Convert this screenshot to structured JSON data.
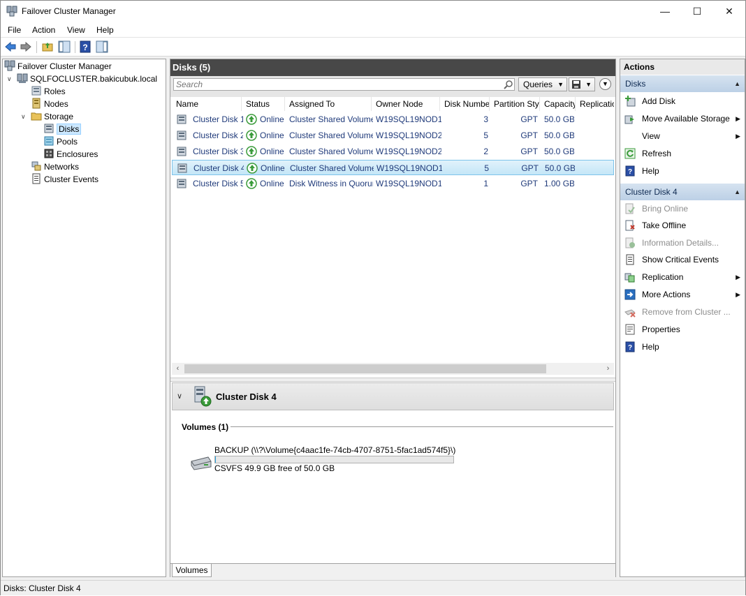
{
  "window": {
    "title": "Failover Cluster Manager"
  },
  "menu": [
    "File",
    "Action",
    "View",
    "Help"
  ],
  "tree": {
    "root": "Failover Cluster Manager",
    "cluster": "SQLFOCLUSTER.bakicubuk.local",
    "roles": "Roles",
    "nodes": "Nodes",
    "storage": "Storage",
    "disks": "Disks",
    "pools": "Pools",
    "enclosures": "Enclosures",
    "networks": "Networks",
    "events": "Cluster Events"
  },
  "center": {
    "title": "Disks (5)",
    "search_placeholder": "Search",
    "queries_label": "Queries",
    "columns": [
      "Name",
      "Status",
      "Assigned To",
      "Owner Node",
      "Disk Number",
      "Partition Style",
      "Capacity",
      "Replication"
    ],
    "rows": [
      {
        "name": "Cluster Disk 1",
        "status": "Online",
        "assigned": "Cluster Shared Volume",
        "owner": "W19SQL19NOD1",
        "disk_number": "3",
        "partition": "GPT",
        "capacity": "50.0 GB"
      },
      {
        "name": "Cluster Disk 2",
        "status": "Online",
        "assigned": "Cluster Shared Volume",
        "owner": "W19SQL19NOD2",
        "disk_number": "5",
        "partition": "GPT",
        "capacity": "50.0 GB"
      },
      {
        "name": "Cluster Disk 3",
        "status": "Online",
        "assigned": "Cluster Shared Volume",
        "owner": "W19SQL19NOD2",
        "disk_number": "2",
        "partition": "GPT",
        "capacity": "50.0 GB"
      },
      {
        "name": "Cluster Disk 4",
        "status": "Online",
        "assigned": "Cluster Shared Volume",
        "owner": "W19SQL19NOD1",
        "disk_number": "5",
        "partition": "GPT",
        "capacity": "50.0 GB"
      },
      {
        "name": "Cluster Disk 5",
        "status": "Online",
        "assigned": "Disk Witness in Quorum",
        "owner": "W19SQL19NOD1",
        "disk_number": "1",
        "partition": "GPT",
        "capacity": "1.00 GB"
      }
    ],
    "selected_row": 3
  },
  "details": {
    "title": "Cluster Disk 4",
    "volumes_label": "Volumes (1)",
    "volume_name": "BACKUP (\\\\?\\Volume{c4aac1fe-74cb-4707-8751-5fac1ad574f5}\\)",
    "volume_free": "CSVFS 49.9 GB free of 50.0 GB",
    "volume_used_fraction": 0.002,
    "tab": "Volumes"
  },
  "actions": {
    "title": "Actions",
    "section1": "Disks",
    "add_disk": "Add Disk",
    "move_storage": "Move Available Storage",
    "view": "View",
    "refresh": "Refresh",
    "help1": "Help",
    "section2": "Cluster Disk 4",
    "bring_online": "Bring Online",
    "take_offline": "Take Offline",
    "info_details": "Information Details...",
    "critical_events": "Show Critical Events",
    "replication": "Replication",
    "more_actions": "More Actions",
    "remove": "Remove from Cluster ...",
    "properties": "Properties",
    "help2": "Help"
  },
  "status": {
    "text": "Disks:  Cluster Disk 4"
  },
  "watermark": "bakicubuk",
  "colors": {
    "header_dark": "#484848",
    "selection": "#cce8ff",
    "section": "#bcd0e6",
    "link_text": "#1f3a7a",
    "online_green": "#3a9b3a"
  }
}
